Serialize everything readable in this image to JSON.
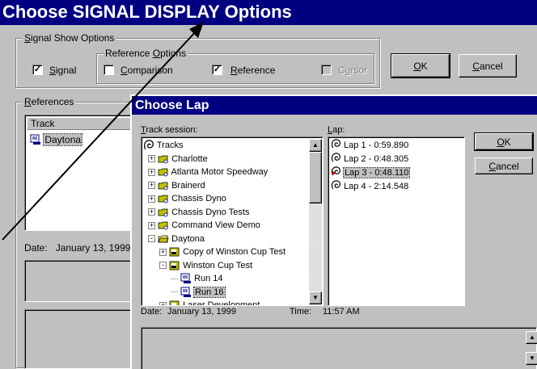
{
  "main_window": {
    "title": "Choose SIGNAL DISPLAY Options",
    "signal_show_options": {
      "label": "Signal Show Options",
      "signal": {
        "label": "Signal",
        "checked": true
      },
      "reference_options_label": "Reference Options",
      "comparison": {
        "label": "Comparison",
        "checked": false
      },
      "reference": {
        "label": "Reference",
        "checked": true
      },
      "cursor": {
        "label": "Cursor",
        "checked": false,
        "enabled": false
      }
    },
    "ok_label": "OK",
    "cancel_label": "Cancel",
    "references": {
      "label": "References",
      "column_track": "Track",
      "items": [
        "Daytona"
      ]
    },
    "date_label": "Date:",
    "date_value": "January 13, 1999"
  },
  "dialog": {
    "title": "Choose Lap",
    "track_session_label": "Track session:",
    "lap_label": "Lap:",
    "ok_label": "OK",
    "cancel_label": "Cancel",
    "tree": [
      {
        "label": "Tracks",
        "icon": "tracks-icon",
        "level": 0,
        "expander": ""
      },
      {
        "label": "Charlotte",
        "icon": "folder-icon",
        "level": 1,
        "expander": "+"
      },
      {
        "label": "Atlanta Motor Speedway",
        "icon": "folder-icon",
        "level": 1,
        "expander": "+"
      },
      {
        "label": "Brainerd",
        "icon": "folder-icon",
        "level": 1,
        "expander": "+"
      },
      {
        "label": "Chassis Dyno",
        "icon": "folder-icon",
        "level": 1,
        "expander": "+"
      },
      {
        "label": "Chassis Dyno Tests",
        "icon": "folder-icon",
        "level": 1,
        "expander": "+"
      },
      {
        "label": "Command View Demo",
        "icon": "folder-icon",
        "level": 1,
        "expander": "+"
      },
      {
        "label": "Daytona",
        "icon": "folder-open-icon",
        "level": 1,
        "expander": "-"
      },
      {
        "label": "Copy of Winston Cup Test",
        "icon": "test-icon",
        "level": 2,
        "expander": "+"
      },
      {
        "label": "Winston Cup Test",
        "icon": "test-icon",
        "level": 2,
        "expander": "-"
      },
      {
        "label": "Run 14",
        "icon": "run-icon",
        "level": 3,
        "expander": ""
      },
      {
        "label": "Run 16",
        "icon": "run-icon",
        "level": 3,
        "expander": "",
        "selected": true
      },
      {
        "label": "Laser Development",
        "icon": "test-icon",
        "level": 2,
        "expander": "+"
      }
    ],
    "laps": [
      {
        "label": "Lap 1 - 0:59.890",
        "icon": "lap-icon",
        "selected": false
      },
      {
        "label": "Lap 2 - 0:48.305",
        "icon": "lap-icon",
        "selected": false
      },
      {
        "label": "Lap 3 - 0:48.110",
        "icon": "fastest-lap-icon",
        "selected": true
      },
      {
        "label": "Lap 4 - 2:14.548",
        "icon": "lap-icon",
        "selected": false
      }
    ],
    "date_label": "Date:",
    "date_value": "January 13, 1999",
    "time_label": "Time:",
    "time_value": "11:57 AM"
  },
  "colors": {
    "titlebar": "#000080",
    "face": "#c0c0c0",
    "folder": "#c0c000",
    "fastest_lap": "#cc0000"
  }
}
